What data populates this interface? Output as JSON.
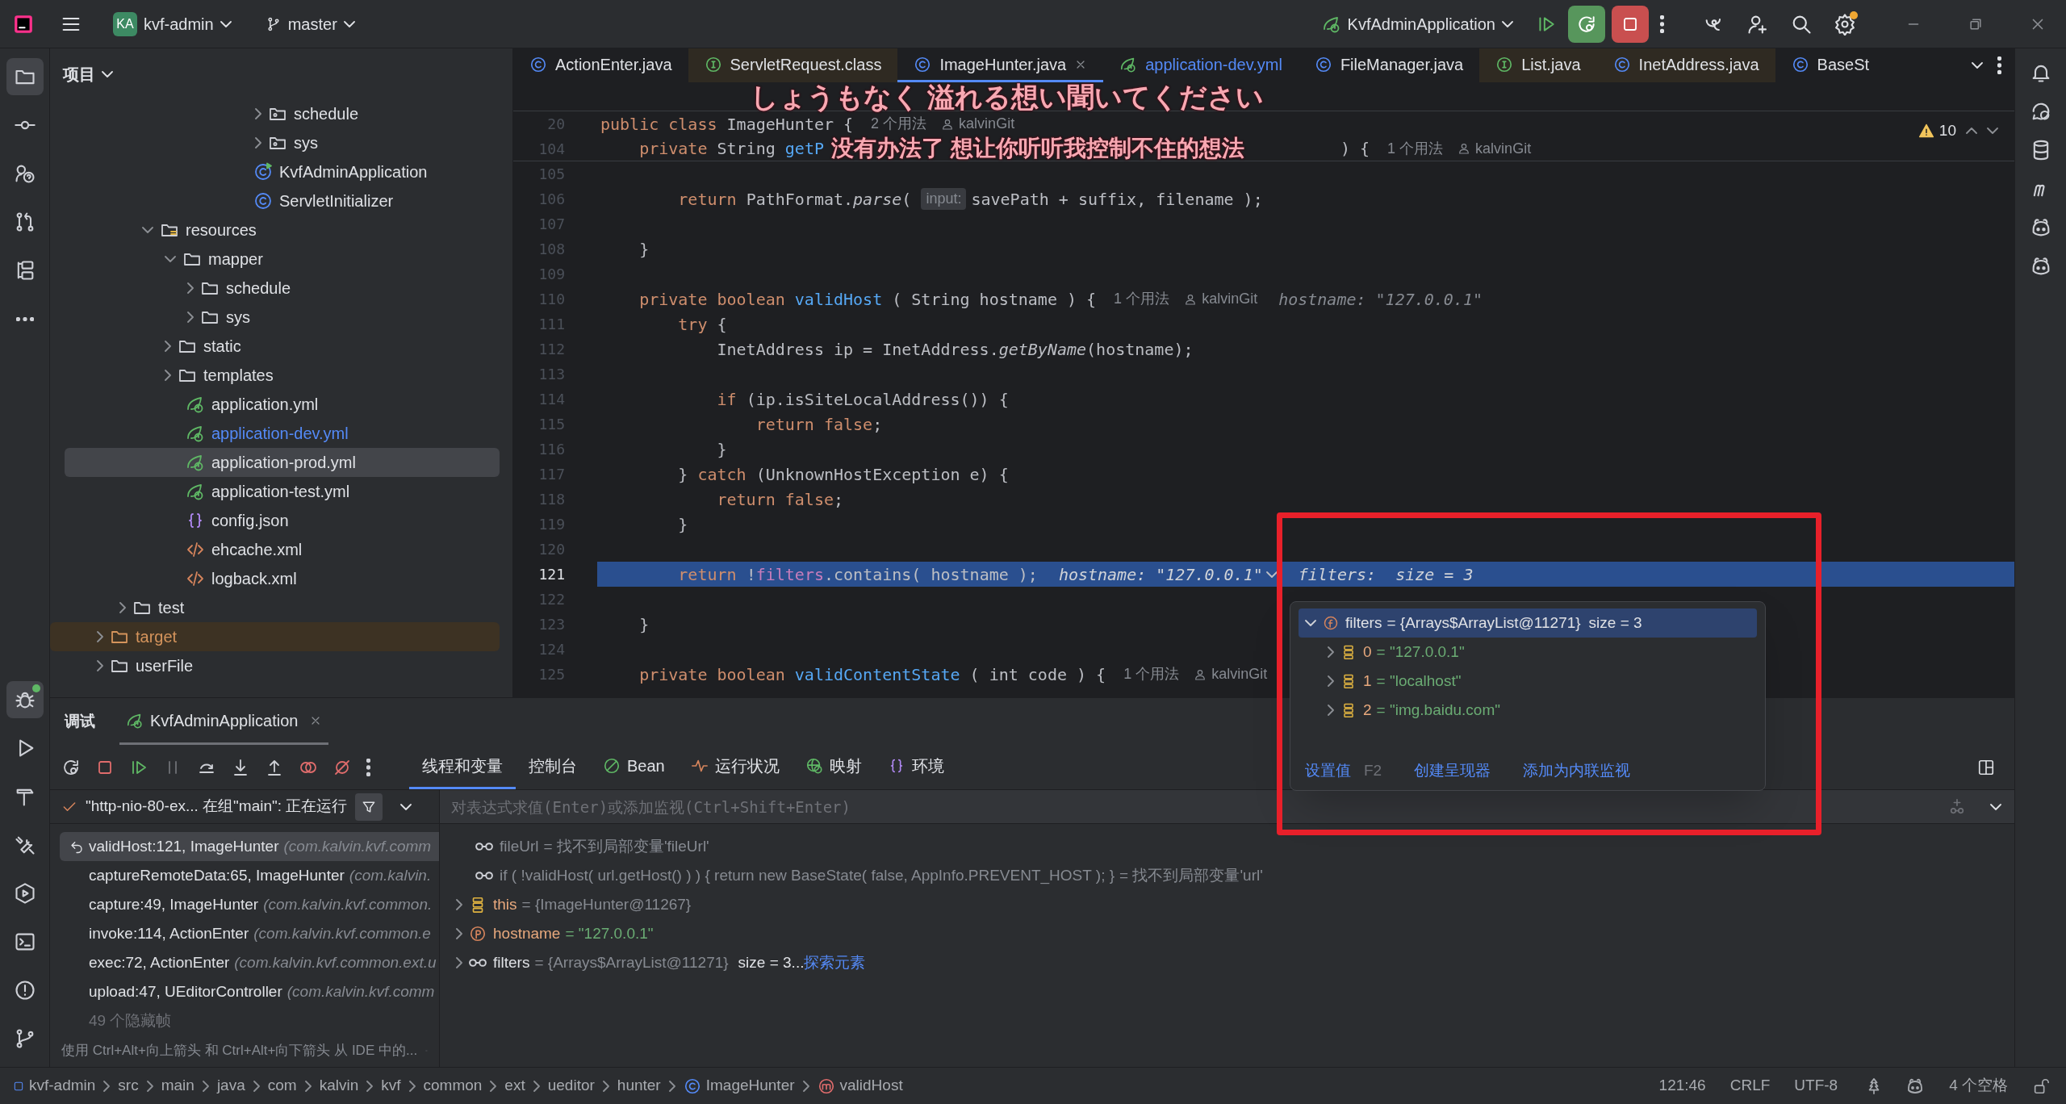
{
  "title_bar": {
    "project_badge": "KA",
    "project": "kvf-admin",
    "branch": "master",
    "run_configuration": "KvfAdminApplication"
  },
  "left_toolbar": {
    "top": [
      {
        "kind": "project",
        "selected": true
      },
      {
        "kind": "commit",
        "selected": false
      },
      {
        "kind": "help",
        "selected": false
      },
      {
        "kind": "pull-requests",
        "selected": false
      },
      {
        "kind": "structure",
        "selected": false
      },
      {
        "kind": "more",
        "selected": false
      }
    ],
    "bottom": [
      {
        "kind": "debug",
        "selected": true
      },
      {
        "kind": "run",
        "selected": false
      },
      {
        "kind": "build",
        "selected": false
      },
      {
        "kind": "services",
        "selected": false
      },
      {
        "kind": "endpoints",
        "selected": false
      },
      {
        "kind": "terminal",
        "selected": false
      },
      {
        "kind": "problems",
        "selected": false
      },
      {
        "kind": "git",
        "selected": false
      }
    ]
  },
  "project_panel": {
    "title": "项目",
    "tree": [
      {
        "children": [
          {
            "children": [
              {
                "children": [
                  {
                    "children": [
                      {
                        "children": [
                          {
                            "children": [
                              {
                                "children": [
                                  {
                                    "label": "schedule",
                                    "kind": "package",
                                    "expanded": false,
                                    "selected": false
                                  },
                                  {
                                    "label": "sys",
                                    "kind": "package",
                                    "expanded": false,
                                    "selected": false
                                  }
                                ]
                              },
                              {
                                "label": "KvfAdminApplication",
                                "kind": "spring-class",
                                "selected": false
                              },
                              {
                                "label": "ServletInitializer",
                                "kind": "class",
                                "selected": false
                              }
                            ]
                          }
                        ]
                      }
                    ]
                  }
                ]
              },
              {
                "label": "resources",
                "kind": "resources",
                "expanded": true,
                "selected": false,
                "children": [
                  {
                    "label": "mapper",
                    "kind": "folder",
                    "expanded": true,
                    "selected": false,
                    "children": [
                      {
                        "label": "schedule",
                        "kind": "folder",
                        "expanded": false,
                        "selected": false
                      },
                      {
                        "label": "sys",
                        "kind": "folder",
                        "expanded": false,
                        "selected": false
                      }
                    ]
                  },
                  {
                    "label": "static",
                    "kind": "folder",
                    "expanded": false,
                    "selected": false
                  },
                  {
                    "label": "templates",
                    "kind": "folder",
                    "expanded": false,
                    "selected": false
                  },
                  {
                    "label": "application.yml",
                    "kind": "spring-config",
                    "selected": false
                  },
                  {
                    "label": "application-dev.yml",
                    "kind": "spring-config",
                    "selected": false,
                    "modified": true
                  },
                  {
                    "label": "application-prod.yml",
                    "kind": "spring-config",
                    "selected": true
                  },
                  {
                    "label": "application-test.yml",
                    "kind": "spring-config",
                    "selected": false
                  },
                  {
                    "label": "config.json",
                    "kind": "json",
                    "selected": false
                  },
                  {
                    "label": "ehcache.xml",
                    "kind": "xml",
                    "selected": false
                  },
                  {
                    "label": "logback.xml",
                    "kind": "xml",
                    "selected": false
                  }
                ]
              }
            ]
          },
          {
            "label": "test",
            "kind": "folder",
            "expanded": false,
            "selected": false
          }
        ]
      },
      {
        "label": "target",
        "kind": "folder",
        "expanded": false,
        "selected": false,
        "excluded": true
      },
      {
        "label": "userFile",
        "kind": "folder",
        "expanded": false,
        "selected": false
      }
    ]
  },
  "editor_tabs": [
    {
      "label": "ActionEnter.java",
      "kind": "class",
      "selected": false,
      "tinted": false
    },
    {
      "label": "ServletRequest.class",
      "kind": "interface",
      "selected": false,
      "tinted": true
    },
    {
      "label": "ImageHunter.java",
      "kind": "class",
      "selected": true,
      "tinted": false
    },
    {
      "label": "application-dev.yml",
      "kind": "spring",
      "selected": false,
      "tinted": false,
      "modified": true
    },
    {
      "label": "FileManager.java",
      "kind": "class",
      "selected": false,
      "tinted": false
    },
    {
      "label": "List.java",
      "kind": "interface",
      "selected": false,
      "tinted": true
    },
    {
      "label": "InetAddress.java",
      "kind": "class",
      "selected": false,
      "tinted": true
    },
    {
      "label": "BaseSt",
      "kind": "class",
      "selected": false,
      "tinted": false
    }
  ],
  "editor": {
    "problems": "10",
    "sticky_lines": [
      {
        "number": "20",
        "segments": [
          {
            "kind": "kw",
            "text": "public class "
          },
          {
            "kind": "plain",
            "text": "ImageHunter {"
          },
          {
            "kind": "hint",
            "text": "2 个用法"
          },
          {
            "kind": "author",
            "text": "kalvinGit"
          }
        ]
      },
      {
        "number": "104",
        "segments": [
          {
            "kind": "kw",
            "text": "    private "
          },
          {
            "kind": "plain",
            "text": "String "
          },
          {
            "kind": "method",
            "text": "getP"
          },
          {
            "kind": "covered"
          },
          {
            "kind": "plain",
            "text": ") {"
          },
          {
            "kind": "hint",
            "text": "1 个用法"
          },
          {
            "kind": "author",
            "text": "kalvinGit"
          }
        ]
      }
    ],
    "lines": [
      {
        "number": "105",
        "current": false
      },
      {
        "number": "106",
        "current": false,
        "segments": [
          {
            "kind": "kw",
            "text": "        return "
          },
          {
            "kind": "plain",
            "text": "PathFormat."
          },
          {
            "kind": "italic",
            "text": "parse"
          },
          {
            "kind": "plain",
            "text": "( "
          },
          {
            "kind": "param_hint",
            "text": "input:"
          },
          {
            "kind": "plain",
            "text": "savePath + suffix, filename );"
          }
        ]
      },
      {
        "number": "107",
        "current": false
      },
      {
        "number": "108",
        "current": false,
        "segments": [
          {
            "kind": "plain",
            "text": "    }"
          }
        ]
      },
      {
        "number": "109",
        "current": false
      },
      {
        "number": "110",
        "current": false,
        "segments": [
          {
            "kind": "kw",
            "text": "    private boolean "
          },
          {
            "kind": "method",
            "text": "validHost"
          },
          {
            "kind": "plain",
            "text": " ( String hostname ) {"
          },
          {
            "kind": "hint",
            "text": "1 个用法"
          },
          {
            "kind": "author",
            "text": "kalvinGit"
          },
          {
            "kind": "debug",
            "text": "hostname: \"127.0.0.1\""
          }
        ]
      },
      {
        "number": "111",
        "current": false,
        "segments": [
          {
            "kind": "kw",
            "text": "        try "
          },
          {
            "kind": "plain",
            "text": "{"
          }
        ]
      },
      {
        "number": "112",
        "current": false,
        "segments": [
          {
            "kind": "plain",
            "text": "            InetAddress ip = InetAddress."
          },
          {
            "kind": "italic",
            "text": "getByName"
          },
          {
            "kind": "plain",
            "text": "(hostname);"
          }
        ]
      },
      {
        "number": "113",
        "current": false
      },
      {
        "number": "114",
        "current": false,
        "segments": [
          {
            "kind": "kw",
            "text": "            if "
          },
          {
            "kind": "plain",
            "text": "(ip.isSiteLocalAddress()) {"
          }
        ]
      },
      {
        "number": "115",
        "current": false,
        "segments": [
          {
            "kind": "kw",
            "text": "                return false"
          },
          {
            "kind": "plain",
            "text": ";"
          }
        ]
      },
      {
        "number": "116",
        "current": false,
        "segments": [
          {
            "kind": "plain",
            "text": "            }"
          }
        ]
      },
      {
        "number": "117",
        "current": false,
        "segments": [
          {
            "kind": "plain",
            "text": "        } "
          },
          {
            "kind": "kw",
            "text": "catch "
          },
          {
            "kind": "plain",
            "text": "(UnknownHostException e) {"
          }
        ]
      },
      {
        "number": "118",
        "current": false,
        "segments": [
          {
            "kind": "kw",
            "text": "            return false"
          },
          {
            "kind": "plain",
            "text": ";"
          }
        ]
      },
      {
        "number": "119",
        "current": false,
        "segments": [
          {
            "kind": "plain",
            "text": "        }"
          }
        ]
      },
      {
        "number": "120",
        "current": false
      },
      {
        "number": "121",
        "current": true,
        "segments": [
          {
            "kind": "kw",
            "text": "        return "
          },
          {
            "kind": "plain",
            "text": "!"
          },
          {
            "kind": "field",
            "text": "filters"
          },
          {
            "kind": "plain",
            "text": ".contains( hostname );"
          },
          {
            "kind": "debug",
            "text": "hostname: \"127.0.0.1\""
          },
          {
            "kind": "dropdown"
          },
          {
            "kind": "debug",
            "text": "filters:  size = 3"
          }
        ]
      },
      {
        "number": "122",
        "current": false
      },
      {
        "number": "123",
        "current": false,
        "segments": [
          {
            "kind": "plain",
            "text": "    }"
          }
        ]
      },
      {
        "number": "124",
        "current": false
      },
      {
        "number": "125",
        "current": false,
        "segments": [
          {
            "kind": "kw",
            "text": "    private boolean "
          },
          {
            "kind": "method",
            "text": "validContentState"
          },
          {
            "kind": "plain",
            "text": " ( int code ) {"
          },
          {
            "kind": "hint",
            "text": "1 个用法"
          },
          {
            "kind": "author",
            "text": "kalvinGit"
          }
        ]
      }
    ]
  },
  "lyrics": [
    "しょうもなく 溢れる想い聞いてください",
    "没有办法了 想让你听听我控制不住的想法"
  ],
  "value_popup": {
    "root": {
      "name": "filters",
      "value": "= {Arrays$ArrayList@11271}",
      "extra": "size = 3",
      "expanded": true,
      "selected": true
    },
    "items": [
      {
        "name": "0",
        "value": "= \"127.0.0.1\"",
        "expanded": false
      },
      {
        "name": "1",
        "value": "= \"localhost\"",
        "expanded": false
      },
      {
        "name": "2",
        "value": "= \"img.baidu.com\"",
        "expanded": false
      }
    ],
    "actions": [
      {
        "label": "设置值",
        "shortcut": "F2"
      },
      {
        "label": "创建呈现器"
      },
      {
        "label": "添加为内联监视"
      }
    ]
  },
  "debug": {
    "title": "调试",
    "session": "KvfAdminApplication",
    "tabs": [
      {
        "label": "线程和变量",
        "kind": "plain",
        "selected": true
      },
      {
        "label": "控制台",
        "kind": "plain",
        "selected": false
      },
      {
        "label": "Bean",
        "kind": "bean",
        "selected": false
      },
      {
        "label": "运行状况",
        "kind": "health",
        "selected": false
      },
      {
        "label": "映射",
        "kind": "mapping",
        "selected": false
      },
      {
        "label": "环境",
        "kind": "env",
        "selected": false
      }
    ],
    "thread": "\"http-nio-80-ex... 在组\"main\": 正在运行",
    "frames": [
      {
        "method": "validHost:121, ImageHunter",
        "location": "(com.kalvin.kvf.comm",
        "selected": true
      },
      {
        "method": "captureRemoteData:65, ImageHunter",
        "location": "(com.kalvin.",
        "selected": false
      },
      {
        "method": "capture:49, ImageHunter",
        "location": "(com.kalvin.kvf.common.",
        "selected": false
      },
      {
        "method": "invoke:114, ActionEnter",
        "location": "(com.kalvin.kvf.common.e",
        "selected": false
      },
      {
        "method": "exec:72, ActionEnter",
        "location": "(com.kalvin.kvf.common.ext.u",
        "selected": false
      },
      {
        "method": "upload:47, UEditorController",
        "location": "(com.kalvin.kvf.comm",
        "selected": false
      }
    ],
    "hidden_frames": "49 个隐藏帧",
    "hint": "使用 Ctrl+Alt+向上箭头 和 Ctrl+Alt+向下箭头 从 IDE 中的...",
    "evaluate_placeholder": "对表达式求值(Enter)或添加监视(Ctrl+Shift+Enter)",
    "variables": [
      {
        "kind": "watch",
        "name": "fileUrl",
        "value": "= 找不到局部变量'fileUrl'",
        "error": true
      },
      {
        "kind": "watch",
        "name": "if ( !validHost( url.getHost() ) ) { return new BaseState( false, AppInfo.PREVENT_HOST ); }",
        "value": "= 找不到局部变量'url'",
        "error": true
      },
      {
        "kind": "object",
        "name": "this",
        "value": "= {ImageHunter@11267}",
        "error": false,
        "expanded": false
      },
      {
        "kind": "param",
        "name": "hostname",
        "value": "= \"127.0.0.1\"",
        "error": false,
        "expanded": false
      },
      {
        "kind": "watch",
        "name": "filters",
        "value": "= {Arrays$ArrayList@11271}",
        "extra": "size = 3...",
        "link": "探索元素",
        "error": false,
        "expanded": false
      }
    ]
  },
  "status_bar": {
    "breadcrumbs": [
      {
        "label": "kvf-admin",
        "kind": "module"
      },
      {
        "label": "src",
        "kind": "plain"
      },
      {
        "label": "main",
        "kind": "plain"
      },
      {
        "label": "java",
        "kind": "plain"
      },
      {
        "label": "com",
        "kind": "plain"
      },
      {
        "label": "kalvin",
        "kind": "plain"
      },
      {
        "label": "kvf",
        "kind": "plain"
      },
      {
        "label": "common",
        "kind": "plain"
      },
      {
        "label": "ext",
        "kind": "plain"
      },
      {
        "label": "ueditor",
        "kind": "plain"
      },
      {
        "label": "hunter",
        "kind": "plain"
      },
      {
        "label": "ImageHunter",
        "kind": "class"
      },
      {
        "label": "validHost",
        "kind": "method"
      }
    ],
    "position": "121:46",
    "line_separator": "CRLF",
    "encoding": "UTF-8",
    "indent": "4 个空格"
  }
}
